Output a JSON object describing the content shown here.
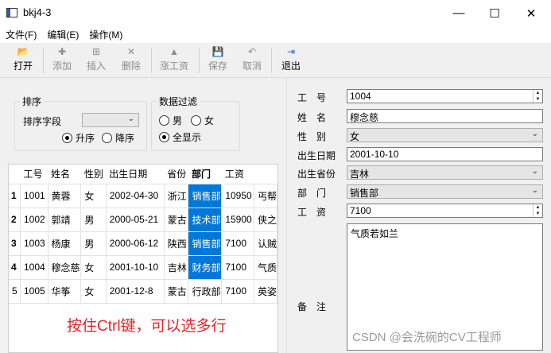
{
  "window": {
    "title": "bkj4-3",
    "min_glyph": "—",
    "max_glyph": "☐",
    "close_glyph": "✕"
  },
  "menu": [
    "文件(F)",
    "编辑(E)",
    "操作(M)"
  ],
  "toolbar": [
    {
      "label": "打开",
      "icon": "folder-open-icon",
      "glyph": "📂",
      "enabled": true
    },
    {
      "label": "添加",
      "icon": "plus-icon",
      "glyph": "✚",
      "enabled": false
    },
    {
      "label": "插入",
      "icon": "insert-icon",
      "glyph": "⊞",
      "enabled": false
    },
    {
      "label": "删除",
      "icon": "delete-icon",
      "glyph": "✕",
      "enabled": false
    },
    {
      "label": "涨工资",
      "icon": "raise-icon",
      "glyph": "▲",
      "enabled": false
    },
    {
      "label": "保存",
      "icon": "save-icon",
      "glyph": "💾",
      "enabled": false
    },
    {
      "label": "取消",
      "icon": "undo-icon",
      "glyph": "↶",
      "enabled": false
    },
    {
      "label": "退出",
      "icon": "exit-icon",
      "glyph": "⇥",
      "enabled": true
    }
  ],
  "sort": {
    "group_title": "排序",
    "field_label": "排序字段",
    "field_value": "",
    "asc_label": "升序",
    "desc_label": "降序",
    "selected": "asc"
  },
  "filter": {
    "group_title": "数据过滤",
    "male_label": "男",
    "female_label": "女",
    "all_label": "全显示",
    "selected": "all"
  },
  "table": {
    "columns": [
      "工号",
      "姓名",
      "性别",
      "出生日期",
      "省份",
      "部门",
      "工资",
      ""
    ],
    "bold_column": 5,
    "rows": [
      {
        "num": "1",
        "cells": [
          "1001",
          "黄蓉",
          "女",
          "2002-04-30",
          "浙江",
          "销售部",
          "10950",
          "丐帮"
        ],
        "selected": [
          5
        ]
      },
      {
        "num": "2",
        "cells": [
          "1002",
          "郭靖",
          "男",
          "2000-05-21",
          "蒙古",
          "技术部",
          "15900",
          "侠之"
        ],
        "selected": [
          5
        ]
      },
      {
        "num": "3",
        "cells": [
          "1003",
          "杨康",
          "男",
          "2000-06-12",
          "陕西",
          "销售部",
          "7100",
          "认贼"
        ],
        "selected": [
          5
        ]
      },
      {
        "num": "4",
        "cells": [
          "1004",
          "穆念慈",
          "女",
          "2001-10-10",
          "吉林",
          "财务部",
          "7100",
          "气质"
        ],
        "selected": [
          5
        ]
      },
      {
        "num": "5",
        "cells": [
          "1005",
          "华筝",
          "女",
          "2001-12-8",
          "蒙古",
          "行政部",
          "7100",
          "英姿"
        ],
        "selected": []
      }
    ],
    "selection_color": "#0078d7"
  },
  "annotation": "按住Ctrl键，可以选多行",
  "form": {
    "id_label": "工　号",
    "id_value": "1004",
    "name_label": "姓　名",
    "name_value": "穆念慈",
    "gender_label": "性　别",
    "gender_value": "女",
    "birth_label": "出生日期",
    "birth_value": "2001-10-10",
    "province_label": "出生省份",
    "province_value": "吉林",
    "dept_label": "部　门",
    "dept_value": "销售部",
    "salary_label": "工　资",
    "salary_value": "7100",
    "memo_label": "备　注",
    "memo_value": "气质若如兰"
  },
  "watermark": "CSDN @会洗碗的CV工程师"
}
